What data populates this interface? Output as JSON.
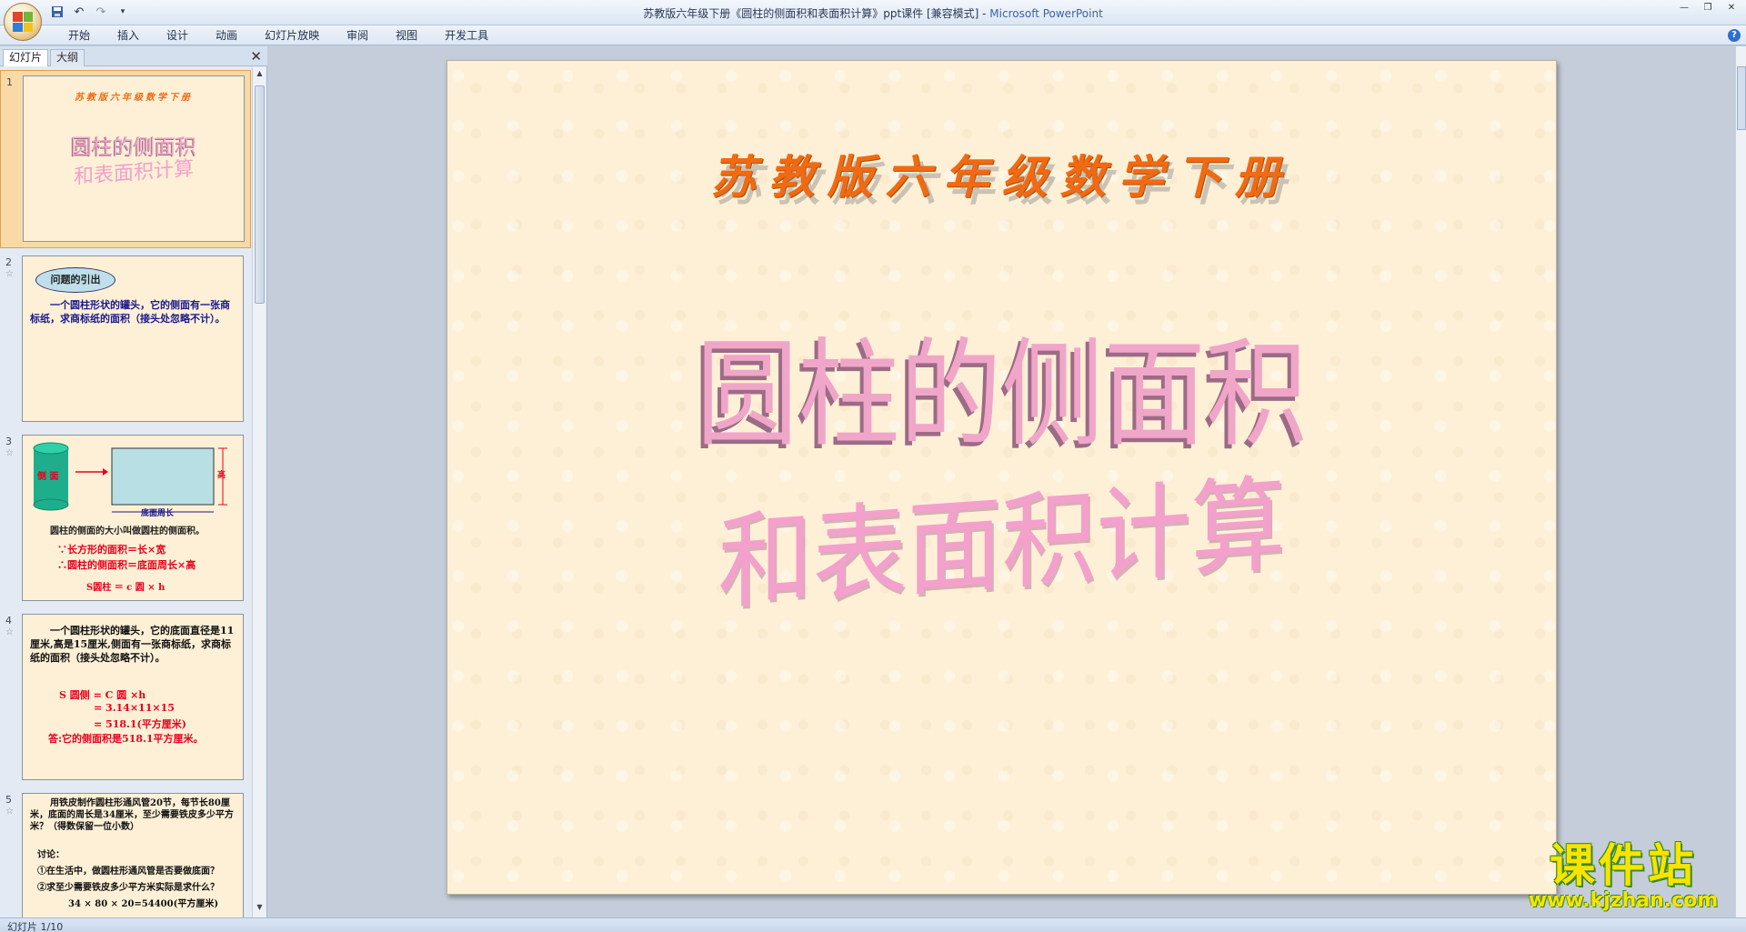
{
  "window": {
    "title": "苏教版六年级下册《圆柱的侧面积和表面积计算》ppt课件 [兼容模式]",
    "app_name": "Microsoft PowerPoint",
    "separator": " - "
  },
  "ribbon": {
    "tabs": [
      "开始",
      "插入",
      "设计",
      "动画",
      "幻灯片放映",
      "审阅",
      "视图",
      "开发工具"
    ]
  },
  "left_pane": {
    "tab_slides": "幻灯片",
    "tab_outline": "大纲"
  },
  "thumbnails": [
    {
      "number": "1",
      "subject": "苏教版六年级数学下册",
      "line1": "圆柱的侧面积",
      "line2": "和表面积计算"
    },
    {
      "number": "2",
      "bubble": "问题的引出",
      "text": "一个圆柱形状的罐头，它的侧面有一张商标纸，求商标纸的面积（接头处忽略不计）。"
    },
    {
      "number": "3",
      "side_label": "侧 面",
      "height_label": "高",
      "base_label": "底面周长",
      "caption": "圆柱的侧面的大小叫做圆柱的侧面积。",
      "line1": "∵长方形的面积＝长×宽",
      "line2": "∴圆柱的侧面积＝底面周长×高",
      "formula": "S圆柱 ＝ c 圆 × h"
    },
    {
      "number": "4",
      "problem": "一个圆柱形状的罐头，它的底面直径是11厘米,高是15厘米,侧面有一张商标纸，求商标纸的面积（接头处忽略不计）。",
      "l1": "S 圆侧 = C 圆 ×h",
      "l2": "= 3.14×11×15",
      "l3": "= 518.1(平方厘米)",
      "answer": "答:它的侧面积是518.1平方厘米。"
    },
    {
      "number": "5",
      "problem": "用铁皮制作圆柱形通风管20节，每节长80厘米，底面的周长是34厘米，至少需要铁皮多少平方米？（得数保留一位小数）",
      "discuss": "讨论：",
      "q1": "①在生活中，做圆柱形通风管是否要做底面？",
      "q2": "②求至少需要铁皮多少平方米实际是求什么？",
      "calc": "34 × 80 × 20=54400(平方厘米)"
    }
  ],
  "slide": {
    "subject": "苏教版六年级数学下册",
    "title_line1": "圆柱的侧面积",
    "title_line2": "和表面积计算"
  },
  "status": {
    "slide_counter": "幻灯片 1/10"
  },
  "watermark": {
    "brand": "课件站",
    "url": "www.kjzhan.com"
  },
  "colors": {
    "subject": "#f06a12",
    "title": "#f0a6c8",
    "slide_bg": "#fdf0d6",
    "accent_red": "#e8001c",
    "accent_blue": "#1a1a8a"
  }
}
